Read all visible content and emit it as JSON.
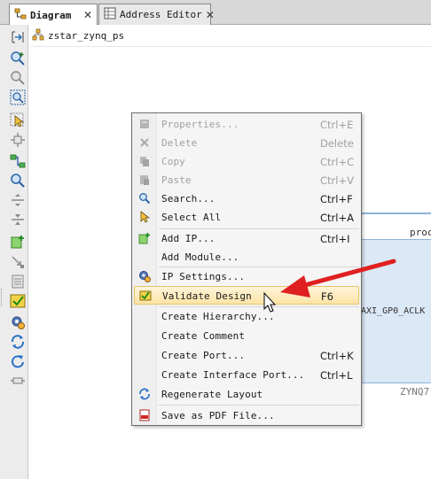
{
  "tabs": [
    {
      "label": "Diagram",
      "active": true
    },
    {
      "label": "Address Editor",
      "active": false
    }
  ],
  "breadcrumb": {
    "label": "zstar_zynq_ps"
  },
  "diagram": {
    "ip_header": "proc",
    "ip_port": "AXI_GP0_ACLK",
    "ip_name": "ZYNQ7"
  },
  "menu": {
    "items": [
      {
        "label": "Properties...",
        "shortcut": "Ctrl+E",
        "icon": "properties-icon",
        "disabled": true
      },
      {
        "label": "Delete",
        "shortcut": "Delete",
        "icon": "delete-icon",
        "disabled": true
      },
      {
        "label": "Copy",
        "shortcut": "Ctrl+C",
        "icon": "copy-icon",
        "disabled": true
      },
      {
        "label": "Paste",
        "shortcut": "Ctrl+V",
        "icon": "paste-icon",
        "disabled": true
      },
      {
        "label": "Search...",
        "shortcut": "Ctrl+F",
        "icon": "search-icon",
        "disabled": false
      },
      {
        "label": "Select All",
        "shortcut": "Ctrl+A",
        "icon": "select-all-icon",
        "disabled": false
      },
      {
        "label": "Add IP...",
        "shortcut": "Ctrl+I",
        "icon": "add-ip-icon",
        "disabled": false
      },
      {
        "label": "Add Module...",
        "shortcut": "",
        "icon": "",
        "disabled": false
      },
      {
        "label": "IP Settings...",
        "shortcut": "",
        "icon": "ip-settings-icon",
        "disabled": false
      },
      {
        "label": "Validate Design",
        "shortcut": "F6",
        "icon": "validate-icon",
        "disabled": false,
        "highlighted": true
      },
      {
        "label": "Create Hierarchy...",
        "shortcut": "",
        "icon": "",
        "disabled": false
      },
      {
        "label": "Create Comment",
        "shortcut": "",
        "icon": "",
        "disabled": false
      },
      {
        "label": "Create Port...",
        "shortcut": "Ctrl+K",
        "icon": "",
        "disabled": false
      },
      {
        "label": "Create Interface Port...",
        "shortcut": "Ctrl+L",
        "icon": "",
        "disabled": false
      },
      {
        "label": "Regenerate Layout",
        "shortcut": "",
        "icon": "regenerate-icon",
        "disabled": false
      },
      {
        "label": "Save as PDF File...",
        "shortcut": "",
        "icon": "pdf-icon",
        "disabled": false
      }
    ]
  },
  "toolbar": {
    "icons": [
      "maximize-icon",
      "zoom-in-icon",
      "zoom-out-icon",
      "zoom-fit-icon",
      "select-area-icon",
      "fit-selection-icon",
      "auto-connect-icon",
      "search-icon",
      "expand-all-icon",
      "collapse-all-icon",
      "add-ip-icon",
      "make-external-icon",
      "validate-icon",
      "drc-icon",
      "ip-settings-icon",
      "regenerate-icon",
      "refresh-icon",
      "route-icon"
    ]
  },
  "colors": {
    "highlight_bg": "#fde4a8",
    "arrow": "#e02020",
    "ip_fill": "#dbe8f6"
  }
}
